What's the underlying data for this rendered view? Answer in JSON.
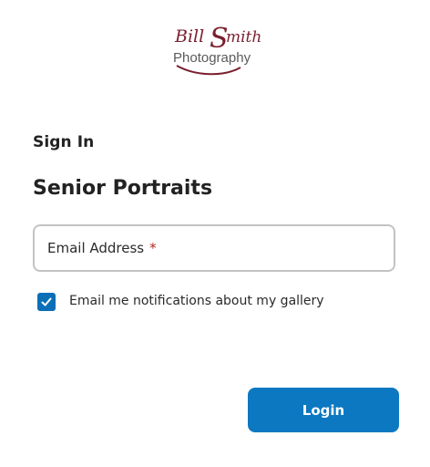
{
  "logo": {
    "script_text": "Bill Smith",
    "sub_text": "Photography",
    "color_script": "#7a1f2e",
    "color_sub": "#5a5a5a"
  },
  "page": {
    "heading": "Sign In",
    "gallery_name": "Senior Portraits"
  },
  "form": {
    "email_label": "Email Address",
    "required_marker": "*",
    "notify_label": "Email me notifications about my gallery",
    "notify_checked": true,
    "login_label": "Login"
  },
  "colors": {
    "accent": "#0b78c1",
    "checkbox": "#0b6fb8",
    "required": "#b3261e",
    "input_border": "#c3c3c3"
  }
}
